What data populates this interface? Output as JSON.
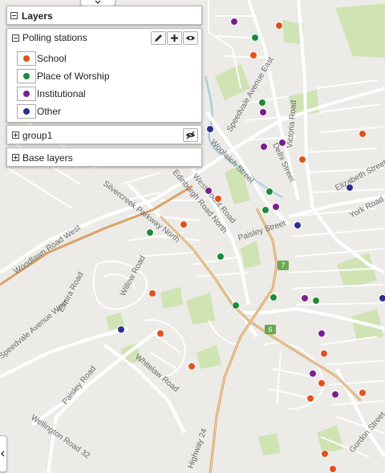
{
  "layers_panel": {
    "title": "Layers"
  },
  "polling_stations": {
    "title": "Polling stations",
    "legend": [
      {
        "label": "School",
        "color": "#e0521d"
      },
      {
        "label": "Place of Worship",
        "color": "#1f8a3b"
      },
      {
        "label": "Institutional",
        "color": "#7a1f8f"
      },
      {
        "label": "Other",
        "color": "#2b2f92"
      }
    ],
    "icons": [
      "pencil-icon",
      "plus-icon",
      "eye-icon"
    ]
  },
  "group1": {
    "title": "group1",
    "icon": "eye-slash-icon"
  },
  "base_layers": {
    "title": "Base layers"
  },
  "map": {
    "road_labels": [
      "Speedvale Avenue East",
      "Delhi Street",
      "Woolwich Street",
      "Westmount Road",
      "Edinburgh Road North",
      "Silvercreek Parkway North",
      "Woodlawn Road West",
      "Paisley Street",
      "Elizabeth Street",
      "York Road",
      "Willow Road",
      "Speedvale Avenue West",
      "Elmira Road",
      "Whitelaw Road",
      "Paisley Road",
      "Wellington Road 32",
      "Highway 24",
      "Victoria Road",
      "Gordon Street"
    ],
    "shields": [
      "7",
      "6"
    ]
  }
}
